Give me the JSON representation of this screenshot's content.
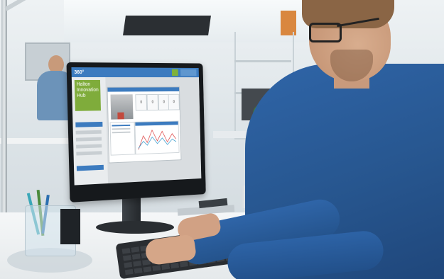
{
  "scene": {
    "description_kind": "photo",
    "monitor_ui": {
      "header_logo": "360°",
      "brand_lines": [
        "Halton",
        "Innovation",
        "Hub"
      ],
      "stat_values": [
        "0",
        "0",
        "0",
        "0"
      ]
    }
  },
  "colors": {
    "ui_blue": "#3c7bbf",
    "brand_green": "#7fac3b",
    "shirt_blue": "#2f65a8"
  }
}
